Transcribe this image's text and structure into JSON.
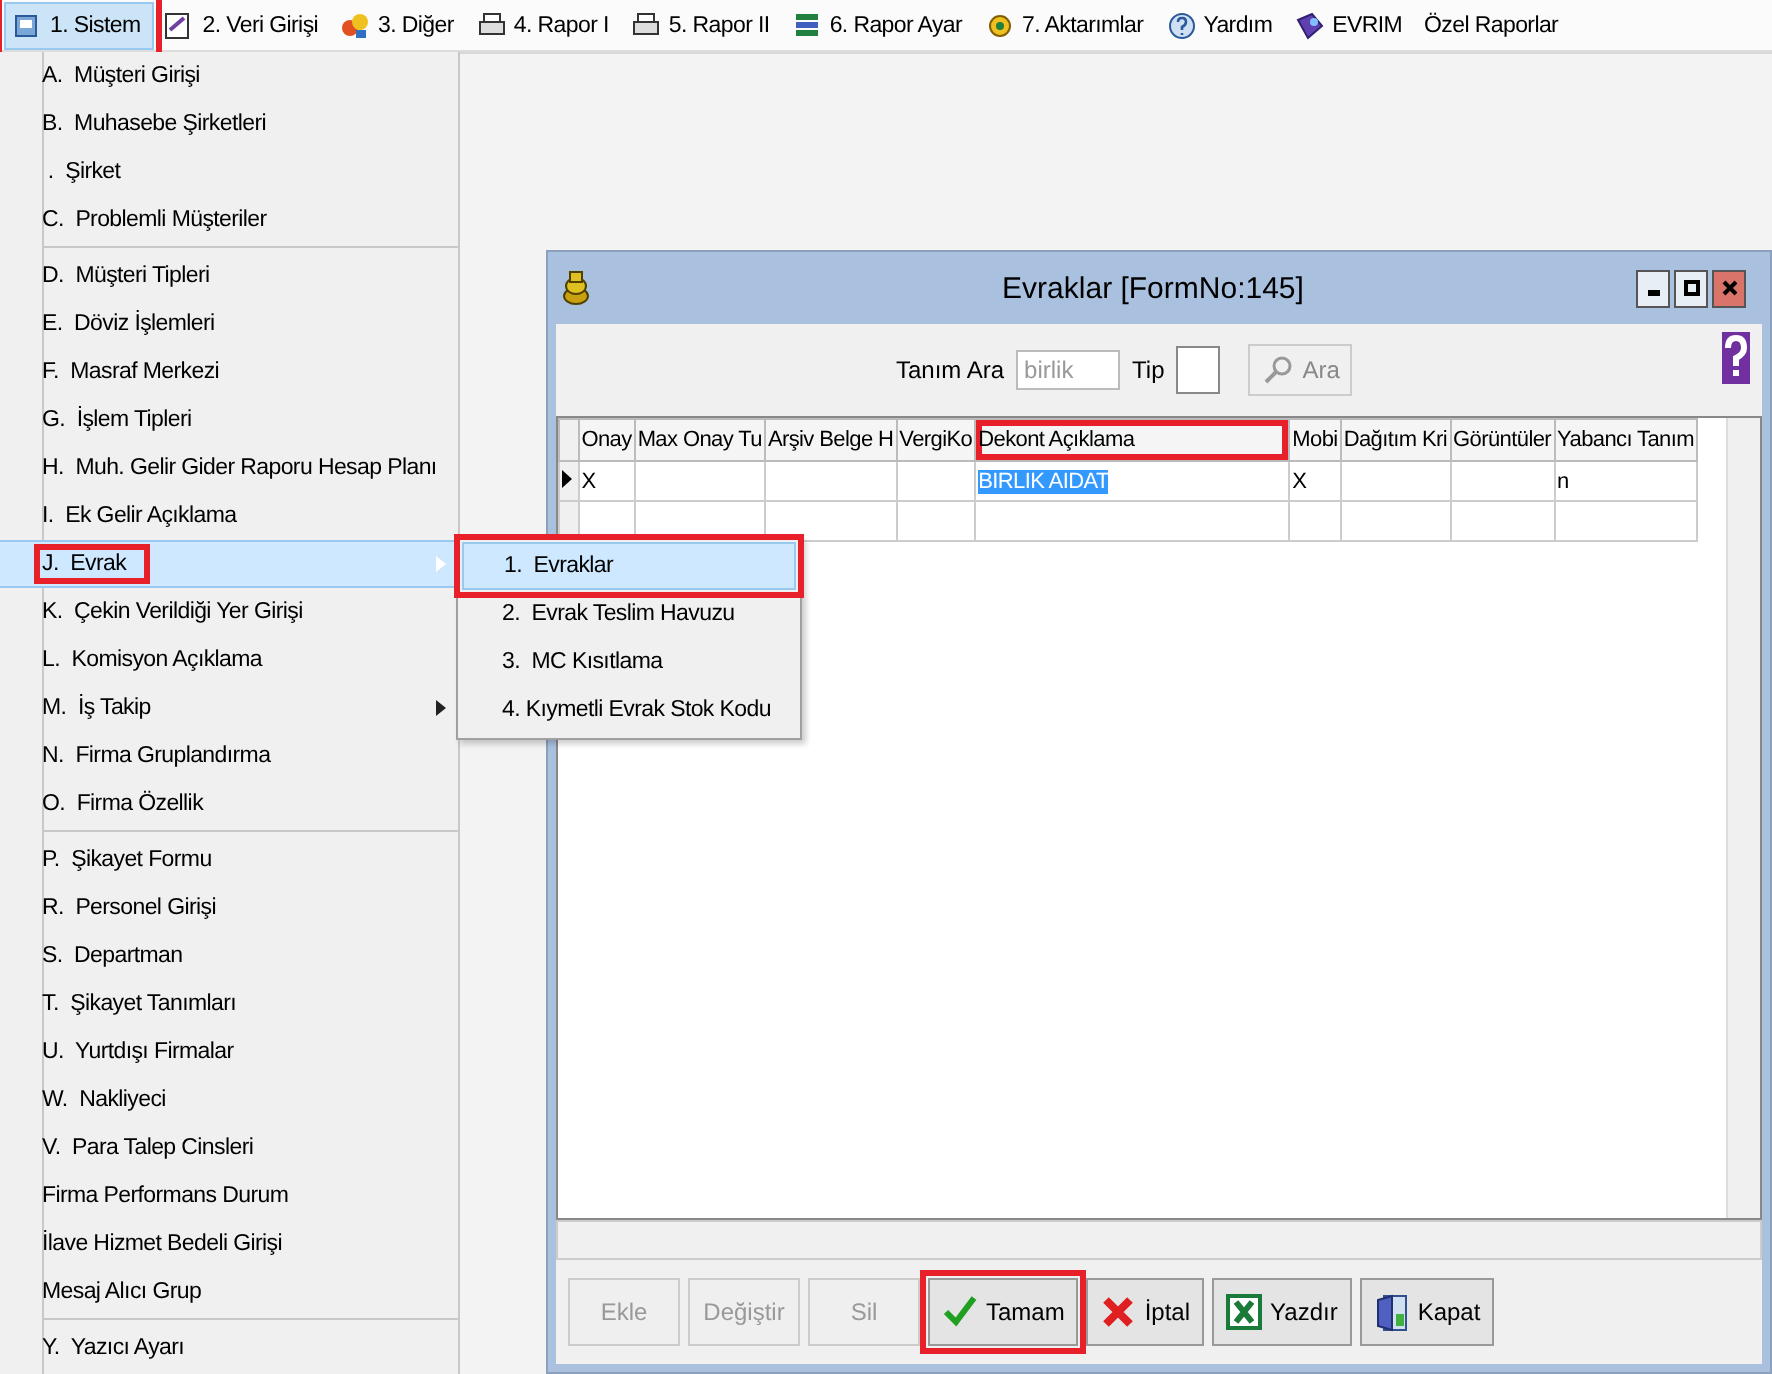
{
  "menu_bar": [
    {
      "label": "1. Sistem",
      "selected": true,
      "annotated": true
    },
    {
      "label": "2. Veri Girişi",
      "selected": false,
      "annotated": false
    },
    {
      "label": "3. Diğer",
      "selected": false,
      "annotated": false
    },
    {
      "label": "4. Rapor I",
      "selected": false,
      "annotated": false
    },
    {
      "label": "5. Rapor II",
      "selected": false,
      "annotated": false
    },
    {
      "label": "6. Rapor Ayar",
      "selected": false,
      "annotated": false
    },
    {
      "label": "7. Aktarımlar",
      "selected": false,
      "annotated": false
    },
    {
      "label": "Yardım",
      "selected": false,
      "annotated": false
    },
    {
      "label": "EVRIM",
      "selected": false,
      "annotated": false
    },
    {
      "label": "Özel Raporlar",
      "selected": false,
      "annotated": false
    }
  ],
  "dropdown": {
    "items": [
      {
        "kind": "item",
        "label": "A.  Müşteri Girişi",
        "selected": false,
        "submenu": false,
        "annotated": false
      },
      {
        "kind": "item",
        "label": "B.  Muhasebe Şirketleri",
        "selected": false,
        "submenu": false,
        "annotated": false
      },
      {
        "kind": "item",
        "label": " .  Şirket",
        "selected": false,
        "submenu": false,
        "annotated": false
      },
      {
        "kind": "item",
        "label": "C.  Problemli Müşteriler",
        "selected": false,
        "submenu": false,
        "annotated": false
      },
      {
        "kind": "separator"
      },
      {
        "kind": "item",
        "label": "D.  Müşteri Tipleri",
        "selected": false,
        "submenu": false,
        "annotated": false
      },
      {
        "kind": "item",
        "label": "E.  Döviz İşlemleri",
        "selected": false,
        "submenu": false,
        "annotated": false
      },
      {
        "kind": "item",
        "label": "F.  Masraf Merkezi",
        "selected": false,
        "submenu": false,
        "annotated": false
      },
      {
        "kind": "item",
        "label": "G.  İşlem Tipleri",
        "selected": false,
        "submenu": false,
        "annotated": false
      },
      {
        "kind": "item",
        "label": "H.  Muh. Gelir Gider Raporu Hesap Planı",
        "selected": false,
        "submenu": false,
        "annotated": false
      },
      {
        "kind": "item",
        "label": "I.  Ek Gelir Açıklama",
        "selected": false,
        "submenu": false,
        "annotated": false
      },
      {
        "kind": "item",
        "label": "J.  Evrak",
        "selected": true,
        "submenu": true,
        "annotated": true
      },
      {
        "kind": "item",
        "label": "K.  Çekin Verildiği Yer Girişi",
        "selected": false,
        "submenu": false,
        "annotated": false
      },
      {
        "kind": "item",
        "label": "L.  Komisyon Açıklama",
        "selected": false,
        "submenu": false,
        "annotated": false
      },
      {
        "kind": "item",
        "label": "M.  İş Takip",
        "selected": false,
        "submenu": true,
        "annotated": false
      },
      {
        "kind": "item",
        "label": "N.  Firma Gruplandırma",
        "selected": false,
        "submenu": false,
        "annotated": false
      },
      {
        "kind": "item",
        "label": "O.  Firma Özellik",
        "selected": false,
        "submenu": false,
        "annotated": false
      },
      {
        "kind": "separator"
      },
      {
        "kind": "item",
        "label": "P.  Şikayet Formu",
        "selected": false,
        "submenu": false,
        "annotated": false
      },
      {
        "kind": "item",
        "label": "R.  Personel Girişi",
        "selected": false,
        "submenu": false,
        "annotated": false
      },
      {
        "kind": "item",
        "label": "S.  Departman",
        "selected": false,
        "submenu": false,
        "annotated": false
      },
      {
        "kind": "item",
        "label": "T.  Şikayet Tanımları",
        "selected": false,
        "submenu": false,
        "annotated": false
      },
      {
        "kind": "item",
        "label": "U.  Yurtdışı Firmalar",
        "selected": false,
        "submenu": false,
        "annotated": false
      },
      {
        "kind": "item",
        "label": "W.  Nakliyeci",
        "selected": false,
        "submenu": false,
        "annotated": false
      },
      {
        "kind": "item",
        "label": "V.  Para Talep Cinsleri",
        "selected": false,
        "submenu": false,
        "annotated": false
      },
      {
        "kind": "item",
        "label": "Firma Performans Durum",
        "selected": false,
        "submenu": false,
        "annotated": false
      },
      {
        "kind": "item",
        "label": "İlave Hizmet Bedeli Girişi",
        "selected": false,
        "submenu": false,
        "annotated": false
      },
      {
        "kind": "item",
        "label": "Mesaj Alıcı Grup",
        "selected": false,
        "submenu": false,
        "annotated": false
      },
      {
        "kind": "separator"
      },
      {
        "kind": "item",
        "label": "Y.  Yazıcı Ayarı",
        "selected": false,
        "submenu": false,
        "annotated": false
      }
    ]
  },
  "submenu": {
    "items": [
      {
        "label": "1.  Evraklar",
        "selected": true,
        "annotated": true
      },
      {
        "label": "2.  Evrak Teslim Havuzu",
        "selected": false,
        "annotated": false
      },
      {
        "label": "3.  MC Kısıtlama",
        "selected": false,
        "annotated": false
      },
      {
        "label": "4. Kıymetli Evrak Stok Kodu",
        "selected": false,
        "annotated": false
      }
    ]
  },
  "window": {
    "title": "Evraklar [FormNo:145]",
    "toolbar": {
      "search_label": "Tanım Ara",
      "search_value": "birlik",
      "type_label": "Tip",
      "search_button": "Ara",
      "search_button_disabled": true
    },
    "table": {
      "columns": [
        {
          "label": "Onay",
          "annotated": false
        },
        {
          "label": "Max Onay Tu",
          "annotated": false
        },
        {
          "label": "Arşiv Belge H",
          "annotated": false
        },
        {
          "label": "VergiKo",
          "annotated": false
        },
        {
          "label": "Dekont Açıklama",
          "annotated": true
        },
        {
          "label": "Mobi",
          "annotated": false
        },
        {
          "label": "Dağıtım Kri",
          "annotated": false
        },
        {
          "label": "Görüntüler",
          "annotated": false
        },
        {
          "label": "Yabancı Tanım",
          "annotated": false
        }
      ],
      "rows": [
        {
          "current": true,
          "cells": [
            {
              "text": "X",
              "selected": false
            },
            {
              "selected": false
            },
            {
              "selected": false
            },
            {
              "selected": false
            },
            {
              "text": "BIRLIK AIDAT",
              "selected": true
            },
            {
              "text": "X",
              "selected": false
            },
            {
              "selected": false
            },
            {
              "selected": false
            },
            {
              "text": "n",
              "selected": false
            }
          ]
        }
      ]
    },
    "buttons": [
      {
        "kind": "plain",
        "label": "Ekle",
        "disabled": true,
        "annotated": false
      },
      {
        "kind": "plain",
        "label": "Değiştir",
        "disabled": true,
        "annotated": false
      },
      {
        "kind": "plain",
        "label": "Sil",
        "disabled": true,
        "annotated": false
      },
      {
        "kind": "ok",
        "label": "Tamam",
        "disabled": false,
        "annotated": true
      },
      {
        "kind": "cancel",
        "label": "İptal",
        "disabled": false,
        "annotated": false
      },
      {
        "kind": "excel",
        "label": "Yazdır",
        "disabled": false,
        "annotated": false
      },
      {
        "kind": "exit",
        "label": "Kapat",
        "disabled": false,
        "annotated": false
      }
    ]
  }
}
